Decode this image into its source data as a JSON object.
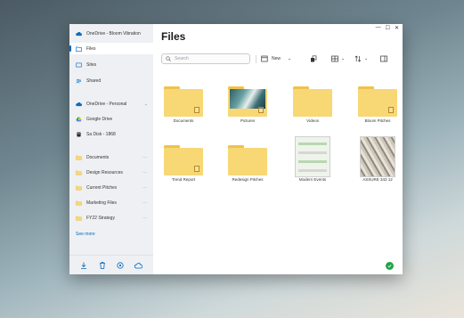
{
  "title": "Files",
  "window_controls": {
    "minimize": "—",
    "maximize": "☐",
    "close": "✕"
  },
  "sidebar": {
    "account_header": "OneDrive - Bloom Vibration",
    "items": [
      {
        "label": "Files",
        "icon": "folder-icon",
        "active": true
      },
      {
        "label": "Sites",
        "icon": "sites-icon"
      },
      {
        "label": "Shared",
        "icon": "shared-icon"
      }
    ],
    "locations": [
      {
        "label": "OneDrive - Personal",
        "icon": "cloud-icon"
      },
      {
        "label": "Google Drive",
        "icon": "google-drive-icon"
      },
      {
        "label": "Sa Disk - 1868",
        "icon": "disk-icon"
      }
    ],
    "folders": [
      {
        "label": "Documents"
      },
      {
        "label": "Design Resources"
      },
      {
        "label": "Current Pitches"
      },
      {
        "label": "Marketing Files"
      },
      {
        "label": "FY22 Strategy"
      }
    ],
    "see_more": "See more",
    "bottom_icons": [
      "download-icon",
      "trash-icon",
      "settings-icon",
      "cloud-sync-icon"
    ]
  },
  "toolbar": {
    "search_placeholder": "Search",
    "new_label": "New",
    "new_icon": "new-icon",
    "share_icon": "share-icon",
    "view_icon": "view-grid-icon",
    "sort_icon": "sort-icon",
    "details_icon": "details-icon"
  },
  "files": [
    {
      "name": "Documents",
      "kind": "folder"
    },
    {
      "name": "Pictures",
      "kind": "folder-photo"
    },
    {
      "name": "Videos",
      "kind": "folder"
    },
    {
      "name": "Bloom Pitches",
      "kind": "folder"
    },
    {
      "name": "Trend Report",
      "kind": "folder"
    },
    {
      "name": "Redesign Pitches",
      "kind": "folder"
    },
    {
      "name": "Modern Events",
      "kind": "image-modern"
    },
    {
      "name": "ASSURE 343 12",
      "kind": "image-arthur"
    }
  ],
  "colors": {
    "accent": "#0067c0",
    "folder": "#f8d775",
    "status": "#22a447"
  }
}
